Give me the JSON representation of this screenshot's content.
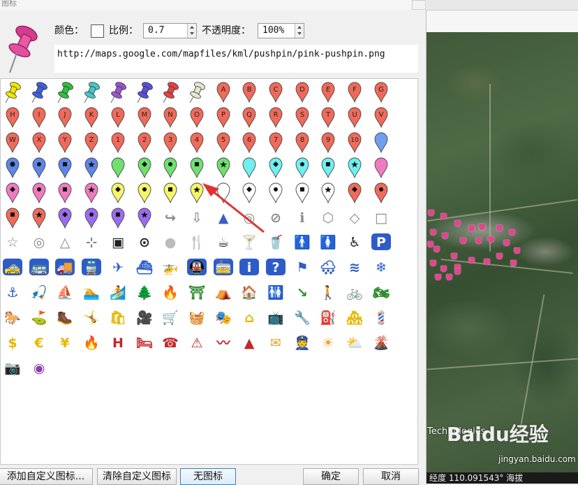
{
  "dialog": {
    "title": "图标",
    "color_label": "颜色：",
    "scale_label": "比例：",
    "scale_value": "0.7",
    "opacity_label": "不透明度：",
    "opacity_value": "100%",
    "url": "http://maps.google.com/mapfiles/kml/pushpin/pink-pushpin.png",
    "preview_icon": "pink-pushpin-icon"
  },
  "icon_rows": [
    [
      {
        "kind": "pushpin",
        "color": "#f2e600"
      },
      {
        "kind": "pushpin",
        "color": "#3f5fd8"
      },
      {
        "kind": "pushpin",
        "color": "#2fbf3f"
      },
      {
        "kind": "pushpin",
        "color": "#46c7c7"
      },
      {
        "kind": "pushpin",
        "color": "#9a55c9"
      },
      {
        "kind": "pushpin",
        "color": "#5a4fd6"
      },
      {
        "kind": "pushpin",
        "color": "#e04545"
      },
      {
        "kind": "pushpin",
        "color": "#e6e6cf"
      },
      {
        "kind": "balloon",
        "color": "#f06a5a",
        "text": "A"
      },
      {
        "kind": "balloon",
        "color": "#f06a5a",
        "text": "B"
      },
      {
        "kind": "balloon",
        "color": "#f06a5a",
        "text": "C"
      },
      {
        "kind": "balloon",
        "color": "#f06a5a",
        "text": "D"
      },
      {
        "kind": "balloon",
        "color": "#f06a5a",
        "text": "E"
      },
      {
        "kind": "balloon",
        "color": "#f06a5a",
        "text": "F"
      },
      {
        "kind": "balloon",
        "color": "#f06a5a",
        "text": "G"
      }
    ],
    [
      {
        "kind": "balloon",
        "color": "#f06a5a",
        "text": "H"
      },
      {
        "kind": "balloon",
        "color": "#f06a5a",
        "text": "I"
      },
      {
        "kind": "balloon",
        "color": "#f06a5a",
        "text": "J"
      },
      {
        "kind": "balloon",
        "color": "#f06a5a",
        "text": "K"
      },
      {
        "kind": "balloon",
        "color": "#f06a5a",
        "text": "L"
      },
      {
        "kind": "balloon",
        "color": "#f06a5a",
        "text": "M"
      },
      {
        "kind": "balloon",
        "color": "#f06a5a",
        "text": "N"
      },
      {
        "kind": "balloon",
        "color": "#f06a5a",
        "text": "O"
      },
      {
        "kind": "balloon",
        "color": "#f06a5a",
        "text": "P"
      },
      {
        "kind": "balloon",
        "color": "#f06a5a",
        "text": "Q"
      },
      {
        "kind": "balloon",
        "color": "#f06a5a",
        "text": "R"
      },
      {
        "kind": "balloon",
        "color": "#f06a5a",
        "text": "S"
      },
      {
        "kind": "balloon",
        "color": "#f06a5a",
        "text": "T"
      },
      {
        "kind": "balloon",
        "color": "#f06a5a",
        "text": "U"
      },
      {
        "kind": "balloon",
        "color": "#f06a5a",
        "text": "V"
      }
    ],
    [
      {
        "kind": "balloon",
        "color": "#f06a5a",
        "text": "W"
      },
      {
        "kind": "balloon",
        "color": "#f06a5a",
        "text": "X"
      },
      {
        "kind": "balloon",
        "color": "#f06a5a",
        "text": "Y"
      },
      {
        "kind": "balloon",
        "color": "#f06a5a",
        "text": "Z"
      },
      {
        "kind": "balloon",
        "color": "#f06a5a",
        "text": "1"
      },
      {
        "kind": "balloon",
        "color": "#f06a5a",
        "text": "2"
      },
      {
        "kind": "balloon",
        "color": "#f06a5a",
        "text": "3"
      },
      {
        "kind": "balloon",
        "color": "#f06a5a",
        "text": "4"
      },
      {
        "kind": "balloon",
        "color": "#f06a5a",
        "text": "5"
      },
      {
        "kind": "balloon",
        "color": "#f06a5a",
        "text": "6"
      },
      {
        "kind": "balloon",
        "color": "#f06a5a",
        "text": "7"
      },
      {
        "kind": "balloon",
        "color": "#f06a5a",
        "text": "8"
      },
      {
        "kind": "balloon",
        "color": "#f06a5a",
        "text": "9"
      },
      {
        "kind": "balloon",
        "color": "#f06a5a",
        "text": "10"
      },
      {
        "kind": "balloon",
        "color": "#6f9ff0",
        "text": ""
      }
    ],
    [
      {
        "kind": "balloon",
        "color": "#5d86e8",
        "mark": "circle"
      },
      {
        "kind": "balloon",
        "color": "#5d86e8",
        "mark": "dot"
      },
      {
        "kind": "balloon",
        "color": "#5d86e8",
        "mark": "square"
      },
      {
        "kind": "balloon",
        "color": "#5d86e8",
        "mark": "star"
      },
      {
        "kind": "balloon",
        "color": "#6fe06f",
        "mark": ""
      },
      {
        "kind": "balloon",
        "color": "#6fe06f",
        "mark": "diamond"
      },
      {
        "kind": "balloon",
        "color": "#6fe06f",
        "mark": "dot"
      },
      {
        "kind": "balloon",
        "color": "#6fe06f",
        "mark": "square"
      },
      {
        "kind": "balloon",
        "color": "#6fe06f",
        "mark": "star"
      },
      {
        "kind": "balloon",
        "color": "#6ff0f0",
        "mark": ""
      },
      {
        "kind": "balloon",
        "color": "#6ff0f0",
        "mark": "diamond"
      },
      {
        "kind": "balloon",
        "color": "#6ff0f0",
        "mark": "dot"
      },
      {
        "kind": "balloon",
        "color": "#6ff0f0",
        "mark": "square"
      },
      {
        "kind": "balloon",
        "color": "#6ff0f0",
        "mark": "star"
      },
      {
        "kind": "balloon",
        "color": "#f07ac0",
        "mark": ""
      }
    ],
    [
      {
        "kind": "balloon",
        "color": "#f07ac0",
        "mark": "diamond"
      },
      {
        "kind": "balloon",
        "color": "#f07ac0",
        "mark": "dot"
      },
      {
        "kind": "balloon",
        "color": "#f07ac0",
        "mark": "square"
      },
      {
        "kind": "balloon",
        "color": "#f07ac0",
        "mark": "star"
      },
      {
        "kind": "balloon",
        "color": "#f5f56a",
        "mark": "diamond"
      },
      {
        "kind": "balloon",
        "color": "#f5f56a",
        "mark": "dot"
      },
      {
        "kind": "balloon",
        "color": "#f5f56a",
        "mark": "square"
      },
      {
        "kind": "balloon",
        "color": "#f5f56a",
        "mark": "star"
      },
      {
        "kind": "balloon",
        "color": "#ffffff",
        "mark": ""
      },
      {
        "kind": "balloon",
        "color": "#ffffff",
        "mark": "diamond"
      },
      {
        "kind": "balloon",
        "color": "#ffffff",
        "mark": "dot"
      },
      {
        "kind": "balloon",
        "color": "#ffffff",
        "mark": "square"
      },
      {
        "kind": "balloon",
        "color": "#ffffff",
        "mark": "star"
      },
      {
        "kind": "balloon",
        "color": "#f06a5a",
        "mark": "diamond"
      },
      {
        "kind": "balloon",
        "color": "#f06a5a",
        "mark": "dot"
      }
    ],
    [
      {
        "kind": "balloon",
        "color": "#f06a5a",
        "mark": "square"
      },
      {
        "kind": "balloon",
        "color": "#f06a5a",
        "mark": "star"
      },
      {
        "kind": "balloon",
        "color": "#9b6cf0",
        "mark": "diamond"
      },
      {
        "kind": "balloon",
        "color": "#9b6cf0",
        "mark": "dot"
      },
      {
        "kind": "balloon",
        "color": "#9b6cf0",
        "mark": "square"
      },
      {
        "kind": "balloon",
        "color": "#9b6cf0",
        "mark": "star"
      },
      {
        "kind": "glyph",
        "name": "turn-arrow",
        "char": "↪",
        "color": "#888"
      },
      {
        "kind": "glyph",
        "name": "down-arrow",
        "char": "⇩",
        "color": "#999"
      },
      {
        "kind": "glyph",
        "name": "direction-arrow",
        "char": "▲",
        "color": "#3b5fc2"
      },
      {
        "kind": "glyph",
        "name": "open-circle",
        "char": "◎",
        "color": "#888"
      },
      {
        "kind": "glyph",
        "name": "no-entry",
        "char": "⊘",
        "color": "#888"
      },
      {
        "kind": "glyph",
        "name": "info",
        "char": "ℹ",
        "color": "#888"
      },
      {
        "kind": "glyph",
        "name": "hexagon",
        "char": "⬡",
        "color": "#888"
      },
      {
        "kind": "glyph",
        "name": "diamond-outline",
        "char": "◇",
        "color": "#888"
      },
      {
        "kind": "glyph",
        "name": "square-outline",
        "char": "□",
        "color": "#888"
      }
    ],
    [
      {
        "kind": "glyph",
        "name": "star-outline",
        "char": "☆",
        "color": "#888"
      },
      {
        "kind": "glyph",
        "name": "target",
        "char": "◎",
        "color": "#888"
      },
      {
        "kind": "glyph",
        "name": "triangle-outline",
        "char": "△",
        "color": "#888"
      },
      {
        "kind": "glyph",
        "name": "crosshair",
        "char": "⊹",
        "color": "#888"
      },
      {
        "kind": "glyph",
        "name": "square-dot",
        "char": "▣",
        "color": "#222"
      },
      {
        "kind": "glyph",
        "name": "circle-dot",
        "char": "⊙",
        "color": "#222"
      },
      {
        "kind": "glyph",
        "name": "gray-sphere",
        "char": "●",
        "color": "#bbb"
      },
      {
        "kind": "glyph",
        "name": "restaurant",
        "char": "🍴",
        "color": "#222"
      },
      {
        "kind": "glyph",
        "name": "coffee",
        "char": "☕",
        "color": "#222"
      },
      {
        "kind": "glyph",
        "name": "bar",
        "char": "🍸",
        "color": "#222"
      },
      {
        "kind": "glyph",
        "name": "snack-bar",
        "char": "🥤",
        "color": "#222"
      },
      {
        "kind": "glyph",
        "name": "man",
        "char": "🚹",
        "color": "#222"
      },
      {
        "kind": "glyph",
        "name": "woman",
        "char": "🚺",
        "color": "#222"
      },
      {
        "kind": "glyph",
        "name": "wheelchair",
        "char": "♿",
        "color": "#222"
      },
      {
        "kind": "glyph",
        "name": "parking",
        "char": "P",
        "color": "#fff",
        "bg": "#2d5cc9"
      }
    ],
    [
      {
        "kind": "glyph",
        "name": "taxi",
        "char": "🚕",
        "color": "#fff",
        "bg": "#2d5cc9"
      },
      {
        "kind": "glyph",
        "name": "bus",
        "char": "🚌",
        "color": "#fff",
        "bg": "#2d5cc9"
      },
      {
        "kind": "glyph",
        "name": "truck",
        "char": "🚚",
        "color": "#fff",
        "bg": "#2d5cc9"
      },
      {
        "kind": "glyph",
        "name": "rail",
        "char": "🚆",
        "color": "#fff",
        "bg": "#2d5cc9"
      },
      {
        "kind": "glyph",
        "name": "airport",
        "char": "✈",
        "color": "#2d5cc9"
      },
      {
        "kind": "glyph",
        "name": "ferry",
        "char": "⛴",
        "color": "#2d5cc9"
      },
      {
        "kind": "glyph",
        "name": "heliport",
        "char": "🚁",
        "color": "#2d5cc9"
      },
      {
        "kind": "glyph",
        "name": "subway",
        "char": "🚇",
        "color": "#fff",
        "bg": "#2d5cc9"
      },
      {
        "kind": "glyph",
        "name": "tram",
        "char": "🚋",
        "color": "#fff",
        "bg": "#2d5cc9"
      },
      {
        "kind": "glyph",
        "name": "info-circle",
        "char": "i",
        "color": "#fff",
        "bg": "#2d5cc9"
      },
      {
        "kind": "glyph",
        "name": "help",
        "char": "?",
        "color": "#fff",
        "bg": "#2d5cc9"
      },
      {
        "kind": "glyph",
        "name": "flag",
        "char": "⚑",
        "color": "#2d5cc9"
      },
      {
        "kind": "glyph",
        "name": "snow-rain",
        "char": "🌨",
        "color": "#2d5cc9"
      },
      {
        "kind": "glyph",
        "name": "water",
        "char": "≋",
        "color": "#2d5cc9"
      },
      {
        "kind": "glyph",
        "name": "snowflake",
        "char": "❄",
        "color": "#2d5cc9"
      }
    ],
    [
      {
        "kind": "glyph",
        "name": "marina",
        "char": "⚓",
        "color": "#2d5cc9"
      },
      {
        "kind": "glyph",
        "name": "fishing",
        "char": "🎣",
        "color": "#2d5cc9"
      },
      {
        "kind": "glyph",
        "name": "sailing",
        "char": "⛵",
        "color": "#2d5cc9"
      },
      {
        "kind": "glyph",
        "name": "swimming",
        "char": "🏊",
        "color": "#2d5cc9"
      },
      {
        "kind": "glyph",
        "name": "water-skiing",
        "char": "🏄",
        "color": "#2d5cc9"
      },
      {
        "kind": "glyph",
        "name": "tree",
        "char": "🌲",
        "color": "#2c8c2c"
      },
      {
        "kind": "glyph",
        "name": "campfire",
        "char": "🔥",
        "color": "#2c8c2c"
      },
      {
        "kind": "glyph",
        "name": "picnic",
        "char": "⛩",
        "color": "#2c8c2c"
      },
      {
        "kind": "glyph",
        "name": "campground",
        "char": "⛺",
        "color": "#2c8c2c"
      },
      {
        "kind": "glyph",
        "name": "ranger-station",
        "char": "🏠",
        "color": "#2c8c2c"
      },
      {
        "kind": "glyph",
        "name": "toilets",
        "char": "🚻",
        "color": "#2c8c2c"
      },
      {
        "kind": "glyph",
        "name": "poi",
        "char": "↘",
        "color": "#2c8c2c"
      },
      {
        "kind": "glyph",
        "name": "hiker",
        "char": "🚶",
        "color": "#2c8c2c"
      },
      {
        "kind": "glyph",
        "name": "cycling",
        "char": "🚲",
        "color": "#2c8c2c"
      },
      {
        "kind": "glyph",
        "name": "motorcycling",
        "char": "🏍",
        "color": "#2c8c2c"
      }
    ],
    [
      {
        "kind": "glyph",
        "name": "horseback",
        "char": "🐎",
        "color": "#2c8c2c"
      },
      {
        "kind": "glyph",
        "name": "golf",
        "char": "⛳",
        "color": "#2c8c2c"
      },
      {
        "kind": "glyph",
        "name": "trail",
        "char": "🥾",
        "color": "#2c8c2c"
      },
      {
        "kind": "glyph",
        "name": "play",
        "char": "🤸",
        "color": "#2c8c2c"
      },
      {
        "kind": "glyph",
        "name": "shopping",
        "char": "🛍",
        "color": "#e6b800"
      },
      {
        "kind": "glyph",
        "name": "movies",
        "char": "🎥",
        "color": "#e6b800"
      },
      {
        "kind": "glyph",
        "name": "grocery",
        "char": "🛒",
        "color": "#e6b800"
      },
      {
        "kind": "glyph",
        "name": "shopping-cart",
        "char": "🧺",
        "color": "#e6b800"
      },
      {
        "kind": "glyph",
        "name": "arts",
        "char": "🎭",
        "color": "#e6b800"
      },
      {
        "kind": "glyph",
        "name": "homegardenbusiness",
        "char": "⌂",
        "color": "#e6b800"
      },
      {
        "kind": "glyph",
        "name": "electronics",
        "char": "📺",
        "color": "#e6b800"
      },
      {
        "kind": "glyph",
        "name": "mechanic",
        "char": "🔧",
        "color": "#e6b800"
      },
      {
        "kind": "glyph",
        "name": "gas-station",
        "char": "⛽",
        "color": "#e6b800"
      },
      {
        "kind": "glyph",
        "name": "realestate",
        "char": "🏘",
        "color": "#e6b800"
      },
      {
        "kind": "glyph",
        "name": "salon",
        "char": "💈",
        "color": "#e6b800"
      }
    ],
    [
      {
        "kind": "glyph",
        "name": "dollar",
        "char": "$",
        "color": "#e6b800"
      },
      {
        "kind": "glyph",
        "name": "euro",
        "char": "€",
        "color": "#e6b800"
      },
      {
        "kind": "glyph",
        "name": "yen",
        "char": "¥",
        "color": "#e6b800"
      },
      {
        "kind": "glyph",
        "name": "firedept",
        "char": "🔥",
        "color": "#c0282a"
      },
      {
        "kind": "glyph",
        "name": "hospitals",
        "char": "H",
        "color": "#c0282a"
      },
      {
        "kind": "glyph",
        "name": "lodging",
        "char": "🛏",
        "color": "#c0282a"
      },
      {
        "kind": "glyph",
        "name": "phone",
        "char": "☎",
        "color": "#c0282a"
      },
      {
        "kind": "glyph",
        "name": "caution",
        "char": "⚠",
        "color": "#c0282a"
      },
      {
        "kind": "glyph",
        "name": "earthquake",
        "char": "〰",
        "color": "#c0282a"
      },
      {
        "kind": "glyph",
        "name": "falling-rocks",
        "char": "▲",
        "color": "#c0282a"
      },
      {
        "kind": "glyph",
        "name": "post-office",
        "char": "✉",
        "color": "#f0a020"
      },
      {
        "kind": "glyph",
        "name": "police",
        "char": "👮",
        "color": "#f0a020"
      },
      {
        "kind": "glyph",
        "name": "sunny",
        "char": "☀",
        "color": "#f0a020"
      },
      {
        "kind": "glyph",
        "name": "partly-cloudy",
        "char": "⛅",
        "color": "#f0a020"
      },
      {
        "kind": "glyph",
        "name": "volcano",
        "char": "🌋",
        "color": "#e05a20"
      }
    ],
    [
      {
        "kind": "glyph",
        "name": "camera",
        "char": "📷",
        "color": "#8a3fb0"
      },
      {
        "kind": "glyph",
        "name": "webcam",
        "char": "◉",
        "color": "#8a3fb0"
      }
    ]
  ],
  "buttons": {
    "add_custom": "添加自定义图标...",
    "clear_custom": "清除自定义图标",
    "no_icon": "无图标",
    "ok": "确定",
    "cancel": "取消"
  },
  "map": {
    "credit": "Technologies",
    "watermark": "Baidu经验",
    "watermark_url": "jingyan.baidu.com",
    "status": "经度  110.091543°  海拔"
  }
}
